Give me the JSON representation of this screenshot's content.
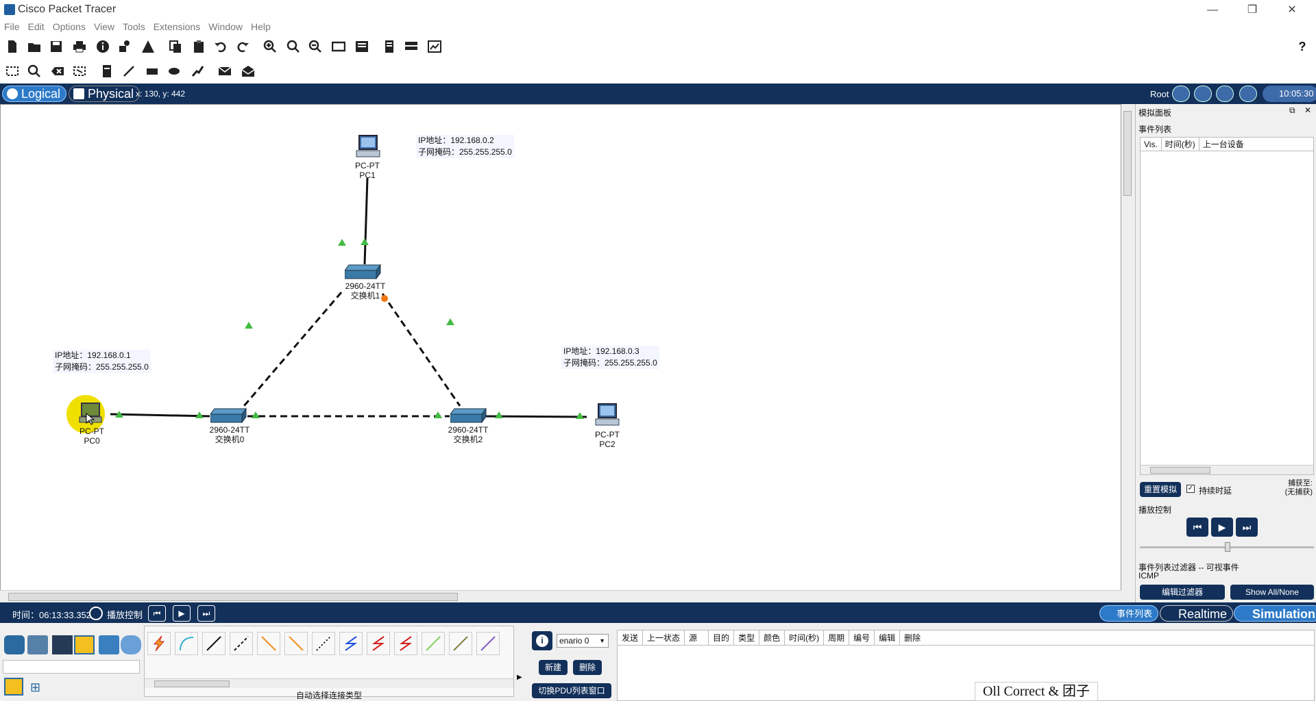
{
  "window": {
    "title": "Cisco Packet Tracer",
    "min": "—",
    "restore": "❐",
    "close": "✕"
  },
  "menu": [
    "File",
    "Edit",
    "Options",
    "View",
    "Tools",
    "Extensions",
    "Window",
    "Help"
  ],
  "help_glyph": "?",
  "viewbar": {
    "logical": "Logical",
    "physical": "Physical",
    "coords": "x: 130, y: 442",
    "root": "Root",
    "clock": "10:05:30"
  },
  "devices": {
    "pc0": {
      "type": "PC-PT",
      "name": "PC0",
      "ip": "IP地址：192.168.0.1",
      "mask": "子网掩码：255.255.255.0"
    },
    "pc1": {
      "type": "PC-PT",
      "name": "PC1",
      "ip": "IP地址：192.168.0.2",
      "mask": "子网掩码：255.255.255.0"
    },
    "pc2": {
      "type": "PC-PT",
      "name": "PC2",
      "ip": "IP地址：192.168.0.3",
      "mask": "子网掩码：255.255.255.0"
    },
    "sw0": {
      "type": "2960-24TT",
      "name": "交换机0"
    },
    "sw1": {
      "type": "2960-24TT",
      "name": "交换机1"
    },
    "sw2": {
      "type": "2960-24TT",
      "name": "交换机2"
    }
  },
  "sim": {
    "panel_title": "模拟面板",
    "event_list": "事件列表",
    "col_vis": "Vis.",
    "col_time": "时间(秒)",
    "col_last": "上一台设备",
    "reset": "重置模拟",
    "const_delay": "持续时延",
    "capture_to": "捕获至:",
    "capture_none": "(无捕获)",
    "play_controls": "播放控制",
    "filter_title": "事件列表过滤器 -- 可视事件",
    "filter_value": "ICMP",
    "edit_filter": "编辑过滤器",
    "show_all": "Show All/None"
  },
  "status": {
    "time": "时间：06:13:33.352",
    "playback": "播放控制",
    "event_list_btn": "事件列表",
    "realtime": "Realtime",
    "simulation": "Simulation"
  },
  "bottom": {
    "auto_connect": "自动选择连接类型",
    "scenario": "enario 0",
    "new": "新建",
    "delete": "删除",
    "toggle_pdu": "切换PDU列表窗口",
    "pdu_columns": [
      "发送",
      "上一状态",
      "源",
      "目的",
      "类型",
      "颜色",
      "时间(秒)",
      "周期",
      "编号",
      "编辑",
      "删除"
    ]
  },
  "watermark": "Oll Correct & 团子",
  "colors": {
    "navy": "#12305a",
    "link_up": "#44bb44",
    "link_orange": "#ee7711",
    "highlight": "#f0e000"
  }
}
